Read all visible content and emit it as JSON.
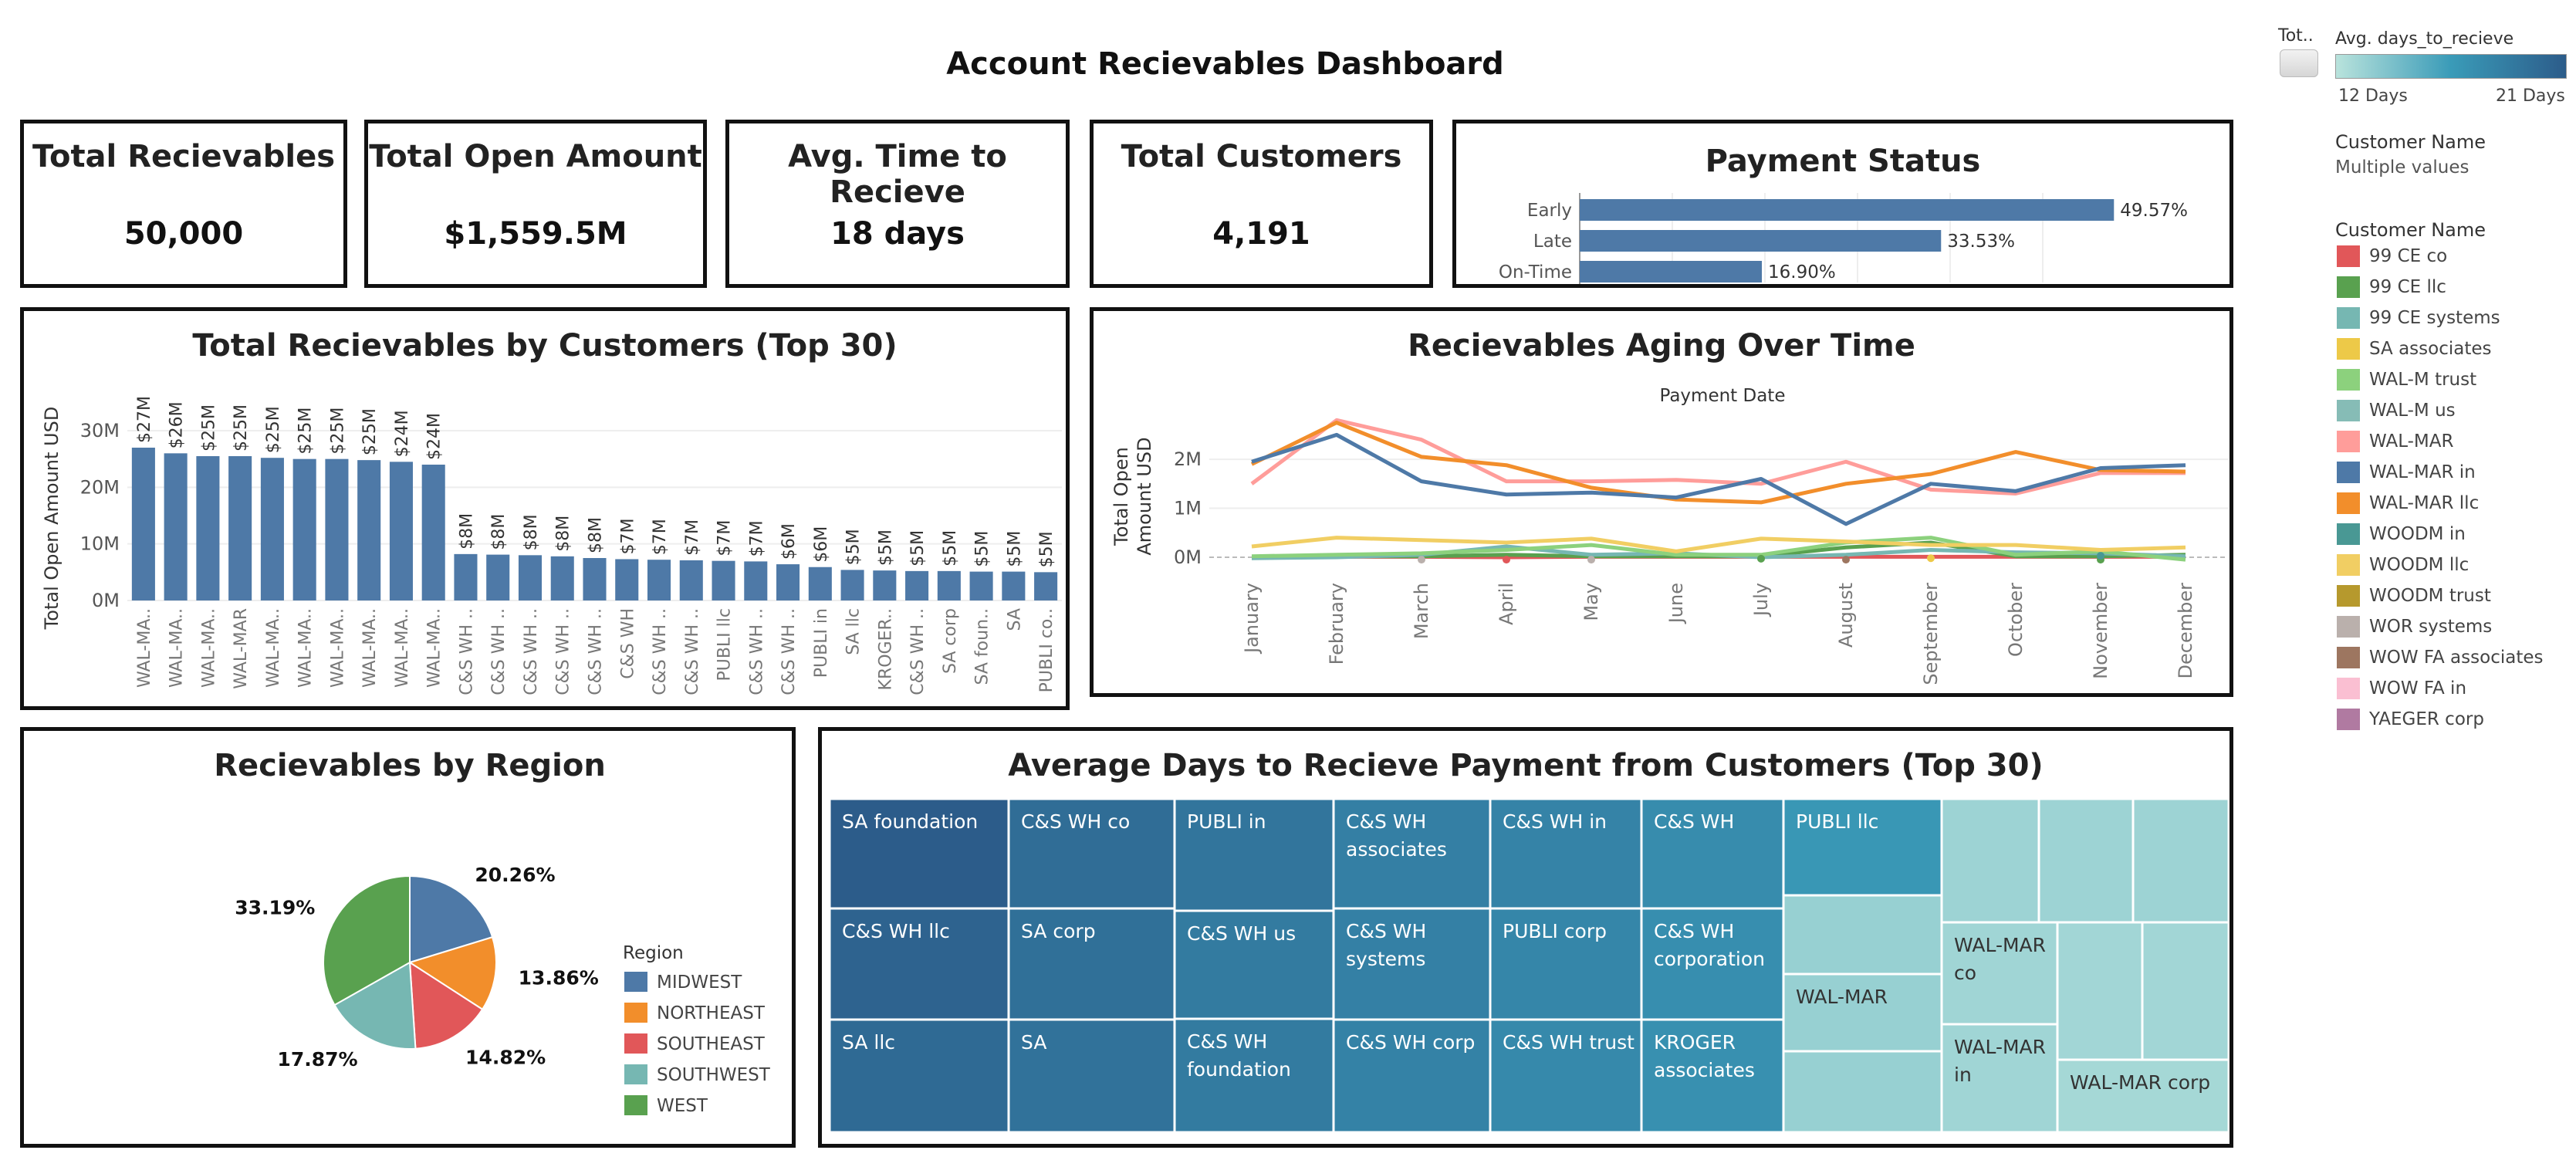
{
  "dashboard": {
    "title": "Account Recievables Dashboard"
  },
  "kpis": [
    {
      "title": "Total Recievables",
      "value": "50,000"
    },
    {
      "title": "Total Open Amount",
      "value": "$1,559.5M"
    },
    {
      "title": "Avg. Time to Recieve",
      "value": "18 days"
    },
    {
      "title": "Total Customers",
      "value": "4,191"
    }
  ],
  "sidebar": {
    "tot_label": "Tot..",
    "gradient_title": "Avg. days_to_recieve",
    "gradient_min": "12 Days",
    "gradient_max": "21 Days",
    "gradient_colors": [
      "#b9e3dc",
      "#2c5c8a"
    ],
    "filter_title": "Customer Name",
    "filter_value": "Multiple values",
    "legend_title": "Customer Name",
    "legend": [
      {
        "name": "99 CE co",
        "color": "#e15759"
      },
      {
        "name": "99 CE llc",
        "color": "#59a14f"
      },
      {
        "name": "99 CE systems",
        "color": "#76b7b2"
      },
      {
        "name": "SA associates",
        "color": "#edc948"
      },
      {
        "name": "WAL-M trust",
        "color": "#8cd17d"
      },
      {
        "name": "WAL-M us",
        "color": "#86bcb6"
      },
      {
        "name": "WAL-MAR",
        "color": "#ff9d9a"
      },
      {
        "name": "WAL-MAR in",
        "color": "#4e79a7"
      },
      {
        "name": "WAL-MAR llc",
        "color": "#f28e2b"
      },
      {
        "name": "WOODM in",
        "color": "#499894"
      },
      {
        "name": "WOODM llc",
        "color": "#f1ce63"
      },
      {
        "name": "WOODM trust",
        "color": "#b6992d"
      },
      {
        "name": "WOR systems",
        "color": "#bab0ac"
      },
      {
        "name": "WOW FA associates",
        "color": "#9d7660"
      },
      {
        "name": "WOW FA in",
        "color": "#fabfd2"
      },
      {
        "name": "YAEGER corp",
        "color": "#b07aa1"
      }
    ]
  },
  "chart_data": [
    {
      "id": "payment-status",
      "type": "bar",
      "orientation": "horizontal",
      "title": "Payment Status",
      "categories": [
        "Early",
        "Late",
        "On-Time"
      ],
      "values": [
        49.57,
        33.53,
        16.9
      ],
      "value_labels": [
        "49.57%",
        "33.53%",
        "16.90%"
      ],
      "xlim": [
        0,
        58
      ],
      "color": "#4e79a7",
      "grid": true
    },
    {
      "id": "top-customers",
      "type": "bar",
      "title": "Total Recievables by Customers (Top 30)",
      "ylabel": "Total Open Amount USD",
      "ylim": [
        0,
        30
      ],
      "yticks": [
        0,
        10,
        20,
        30
      ],
      "ytick_labels": [
        "0M",
        "10M",
        "20M",
        "30M"
      ],
      "color": "#4e79a7",
      "categories": [
        "WAL-MA..",
        "WAL-MA..",
        "WAL-MA..",
        "WAL-MAR",
        "WAL-MA..",
        "WAL-MA..",
        "WAL-MA..",
        "WAL-MA..",
        "WAL-MA..",
        "WAL-MA..",
        "C&S WH ..",
        "C&S WH ..",
        "C&S WH ..",
        "C&S WH ..",
        "C&S WH ..",
        "C&S WH",
        "C&S WH ..",
        "C&S WH ..",
        "PUBLI llc",
        "C&S WH ..",
        "C&S WH ..",
        "PUBLI in",
        "SA llc",
        "KROGER..",
        "C&S WH ..",
        "SA corp",
        "SA foun..",
        "SA",
        "PUBLI co.."
      ],
      "values": [
        27,
        26,
        25.5,
        25.5,
        25.2,
        25,
        25,
        24.8,
        24.5,
        24,
        8.2,
        8.1,
        8,
        7.8,
        7.5,
        7.3,
        7.2,
        7.1,
        7,
        6.9,
        6.4,
        5.9,
        5.4,
        5.3,
        5.2,
        5.2,
        5.1,
        5.1,
        5
      ],
      "value_labels": [
        "$27M",
        "$26M",
        "$25M",
        "$25M",
        "$25M",
        "$25M",
        "$25M",
        "$25M",
        "$24M",
        "$24M",
        "$8M",
        "$8M",
        "$8M",
        "$8M",
        "$8M",
        "$7M",
        "$7M",
        "$7M",
        "$7M",
        "$7M",
        "$6M",
        "$6M",
        "$5M",
        "$5M",
        "$5M",
        "$5M",
        "$5M",
        "$5M",
        "$5M"
      ],
      "grid": true
    },
    {
      "id": "aging",
      "type": "line",
      "title": "Recievables Aging Over Time",
      "subtitle": "Payment Date",
      "ylabel": "Total Open Amount USD",
      "ylim": [
        -0.3,
        2.9
      ],
      "yticks": [
        0,
        1,
        2
      ],
      "ytick_labels": [
        "0M",
        "1M",
        "2M"
      ],
      "x": [
        "January",
        "February",
        "March",
        "April",
        "May",
        "June",
        "July",
        "August",
        "September",
        "October",
        "November",
        "December"
      ],
      "series": [
        {
          "name": "WAL-MAR in",
          "color": "#4e79a7",
          "values": [
            1.95,
            2.5,
            1.55,
            1.28,
            1.32,
            1.22,
            1.6,
            0.68,
            1.5,
            1.35,
            1.82,
            1.88
          ]
        },
        {
          "name": "WAL-MAR llc",
          "color": "#f28e2b",
          "values": [
            1.9,
            2.75,
            2.05,
            1.88,
            1.42,
            1.18,
            1.12,
            1.5,
            1.7,
            2.15,
            1.78,
            1.75
          ]
        },
        {
          "name": "WAL-MAR",
          "color": "#ff9d9a",
          "values": [
            1.5,
            2.8,
            2.4,
            1.55,
            1.55,
            1.58,
            1.5,
            1.95,
            1.38,
            1.3,
            1.72,
            1.72
          ]
        },
        {
          "name": "WOODM llc",
          "color": "#f1ce63",
          "values": [
            0.22,
            0.4,
            0.35,
            0.3,
            0.38,
            0.12,
            0.38,
            0.32,
            0.25,
            0.25,
            0.15,
            0.2
          ]
        },
        {
          "name": "WAL-M trust",
          "color": "#8cd17d",
          "values": [
            0.02,
            0.05,
            0.08,
            0.15,
            0.25,
            0.05,
            0.05,
            0.3,
            0.4,
            0.05,
            0.12,
            -0.05
          ]
        },
        {
          "name": "99 CE systems",
          "color": "#76b7b2",
          "values": [
            -0.02,
            0.0,
            0.05,
            0.22,
            0.05,
            0.08,
            0.0,
            0.05,
            0.15,
            0.1,
            0.08,
            0.02
          ]
        },
        {
          "name": "99 CE llc",
          "color": "#59a14f",
          "values": [
            0.0,
            0.02,
            0.02,
            0.05,
            0.02,
            0.02,
            0.02,
            0.2,
            0.3,
            0.02,
            0.02,
            0.05
          ]
        },
        {
          "name": "99 CE co",
          "color": "#e15759",
          "values": [
            0.01,
            0.01,
            0.01,
            0.0,
            0.01,
            0.01,
            0.01,
            0.01,
            0.01,
            0.01,
            0.01,
            0.01
          ]
        }
      ],
      "points": [
        {
          "x": "March",
          "y": -0.05,
          "color": "#bab0ac"
        },
        {
          "x": "April",
          "y": -0.05,
          "color": "#e15759"
        },
        {
          "x": "May",
          "y": -0.05,
          "color": "#bab0ac"
        },
        {
          "x": "July",
          "y": -0.03,
          "color": "#59a14f"
        },
        {
          "x": "August",
          "y": -0.05,
          "color": "#9d7660"
        },
        {
          "x": "September",
          "y": -0.02,
          "color": "#edc948"
        },
        {
          "x": "November",
          "y": -0.05,
          "color": "#59a14f"
        },
        {
          "x": "November",
          "y": 0.03,
          "color": "#499894"
        }
      ],
      "grid": true
    },
    {
      "id": "region",
      "type": "pie",
      "title": "Recievables by Region",
      "legend_title": "Region",
      "legend_placement": "right",
      "slices": [
        {
          "name": "MIDWEST",
          "value": 20.26,
          "label": "20.26%",
          "color": "#4e79a7"
        },
        {
          "name": "NORTHEAST",
          "value": 13.86,
          "label": "13.86%",
          "color": "#f28e2b"
        },
        {
          "name": "SOUTHEAST",
          "value": 14.82,
          "label": "14.82%",
          "color": "#e15759"
        },
        {
          "name": "SOUTHWEST",
          "value": 17.87,
          "label": "17.87%",
          "color": "#76b7b2"
        },
        {
          "name": "WEST",
          "value": 33.19,
          "label": "33.19%",
          "color": "#59a14f"
        }
      ]
    },
    {
      "id": "treemap",
      "type": "treemap",
      "title": "Average Days to Recieve Payment from Customers (Top 30)",
      "color_range_days": [
        12,
        21
      ],
      "tiles": [
        {
          "label": "SA foundation",
          "days": 21
        },
        {
          "label": "C&S WH llc",
          "days": 20.5
        },
        {
          "label": "SA llc",
          "days": 20
        },
        {
          "label": "C&S WH co",
          "days": 19.8
        },
        {
          "label": "SA corp",
          "days": 19.6
        },
        {
          "label": "SA",
          "days": 19.4
        },
        {
          "label": "PUBLI in",
          "days": 19.2
        },
        {
          "label": "C&S WH us",
          "days": 18.8
        },
        {
          "label": "C&S WH foundation",
          "days": 18.8
        },
        {
          "label": "C&S WH associates",
          "days": 18.5
        },
        {
          "label": "C&S WH systems",
          "days": 18.4
        },
        {
          "label": "C&S WH corp",
          "days": 18.3
        },
        {
          "label": "C&S WH in",
          "days": 18.2
        },
        {
          "label": "PUBLI corp",
          "days": 18.0
        },
        {
          "label": "C&S WH trust",
          "days": 17.8
        },
        {
          "label": "C&S WH",
          "days": 17.6
        },
        {
          "label": "C&S WH corporation",
          "days": 17.4
        },
        {
          "label": "KROGER associates",
          "days": 17.3
        },
        {
          "label": "PUBLI llc",
          "days": 16.8
        },
        {
          "label": "",
          "days": 13.2
        },
        {
          "label": "WAL-MAR",
          "days": 13.2
        },
        {
          "label": "",
          "days": 13.2
        },
        {
          "label": "",
          "days": 13
        },
        {
          "label": "",
          "days": 13
        },
        {
          "label": "",
          "days": 13
        },
        {
          "label": "WAL-MAR co",
          "days": 12.9
        },
        {
          "label": "WAL-MAR in",
          "days": 12.9
        },
        {
          "label": "",
          "days": 12.8
        },
        {
          "label": "",
          "days": 12.8
        },
        {
          "label": "WAL-MAR corp",
          "days": 12.7
        }
      ]
    }
  ]
}
